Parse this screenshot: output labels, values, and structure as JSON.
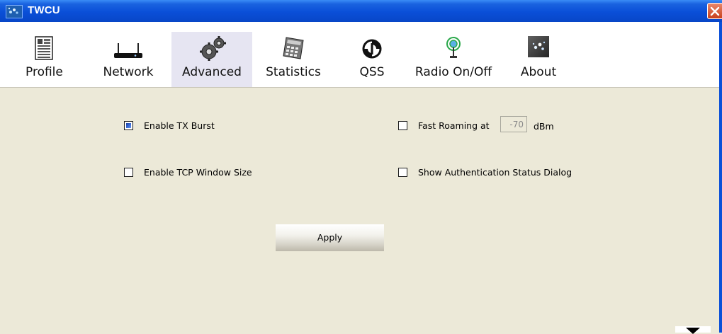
{
  "window": {
    "title": "TWCU"
  },
  "tabs": [
    {
      "label": "Profile",
      "icon": "document-icon"
    },
    {
      "label": "Network",
      "icon": "router-icon"
    },
    {
      "label": "Advanced",
      "icon": "gears-icon",
      "active": true
    },
    {
      "label": "Statistics",
      "icon": "calculator-icon"
    },
    {
      "label": "QSS",
      "icon": "qss-icon"
    },
    {
      "label": "Radio On/Off",
      "icon": "radio-antenna-icon"
    },
    {
      "label": "About",
      "icon": "about-icon"
    }
  ],
  "options": {
    "tx_burst": {
      "label": "Enable TX Burst",
      "checked": true
    },
    "tcp_window": {
      "label": "Enable TCP Window Size",
      "checked": false
    },
    "fast_roaming": {
      "label": "Fast Roaming at",
      "checked": false,
      "value": "-70",
      "unit": "dBm"
    },
    "auth_dialog": {
      "label": "Show Authentication Status Dialog",
      "checked": false
    }
  },
  "apply_label": "Apply",
  "colors": {
    "titlebar": "#0A4FD8",
    "background": "#ECE9D8",
    "active_tab": "#E6E5F2",
    "close": "#C8401C"
  }
}
